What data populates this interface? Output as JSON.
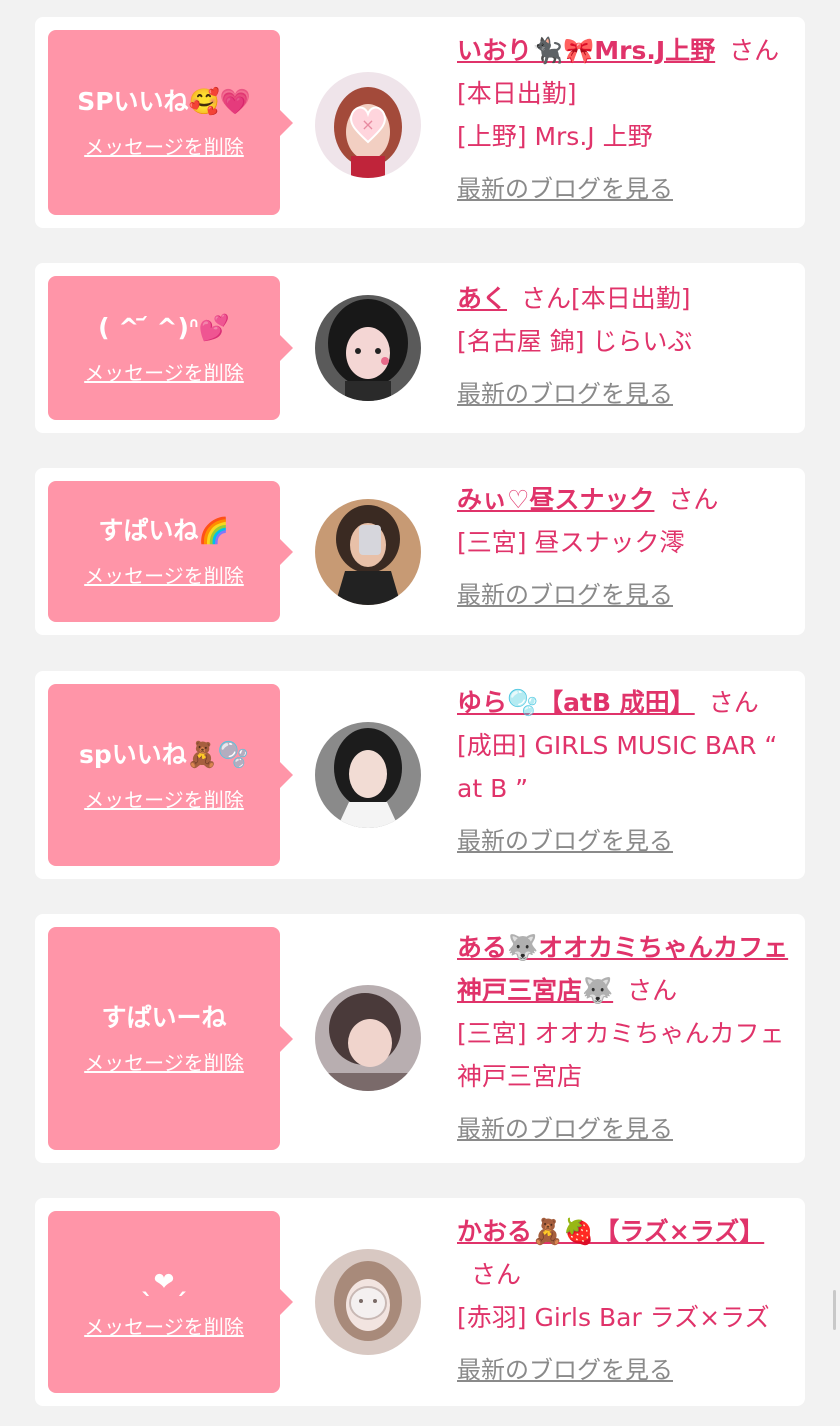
{
  "items": [
    {
      "bubble_message": "SPいいね🥰💗",
      "delete_label": "メッセージを削除",
      "cast_name": "いおり🐈‍⬛🎀Mrs.J上野",
      "san": "さん",
      "status": "[本日出勤]",
      "area_shop": "[上野] Mrs.J 上野",
      "blog_label": "最新のブログを見る"
    },
    {
      "bubble_message": "( ^ ᷄ ^)ᐢ💕",
      "delete_label": "メッセージを削除",
      "cast_name": "あく",
      "san": "さん",
      "status": "[本日出勤]",
      "area_shop": "[名古屋 錦] じらいぶ",
      "blog_label": "最新のブログを見る"
    },
    {
      "bubble_message": "すぱいね🌈",
      "delete_label": "メッセージを削除",
      "cast_name": "みぃ♡昼スナック",
      "san": "さん",
      "status": "",
      "area_shop": "[三宮] 昼スナック澪",
      "blog_label": "最新のブログを見る"
    },
    {
      "bubble_message": "spいいね🧸🫧",
      "delete_label": "メッセージを削除",
      "cast_name": "ゆら🫧【atB 成田】",
      "san": "さん",
      "status": "",
      "area_shop": "[成田] GIRLS MUSIC BAR “ at B ”",
      "blog_label": "最新のブログを見る"
    },
    {
      "bubble_message": "すぱいーね",
      "delete_label": "メッセージを削除",
      "cast_name": "ある🐺オオカミちゃんカフェ神戸三宮店🐺",
      "san": "さん",
      "status": "",
      "area_shop": "[三宮] オオカミちゃんカフェ神戸三宮店",
      "blog_label": "最新のブログを見る"
    },
    {
      "bubble_message": "ˎ❤︎ˏ",
      "delete_label": "メッセージを削除",
      "cast_name": "かおる🧸🍓【ラズ×ラズ】",
      "san": "さん",
      "status": "",
      "area_shop": "[赤羽] Girls Bar ラズ×ラズ",
      "blog_label": "最新のブログを見る"
    }
  ],
  "colors": {
    "page_bg": "#f2f2f2",
    "card_bg": "#ffffff",
    "bubble_bg": "#ff95a8",
    "name_pink": "#e0336a",
    "blog_gray": "#8a8a8a"
  }
}
